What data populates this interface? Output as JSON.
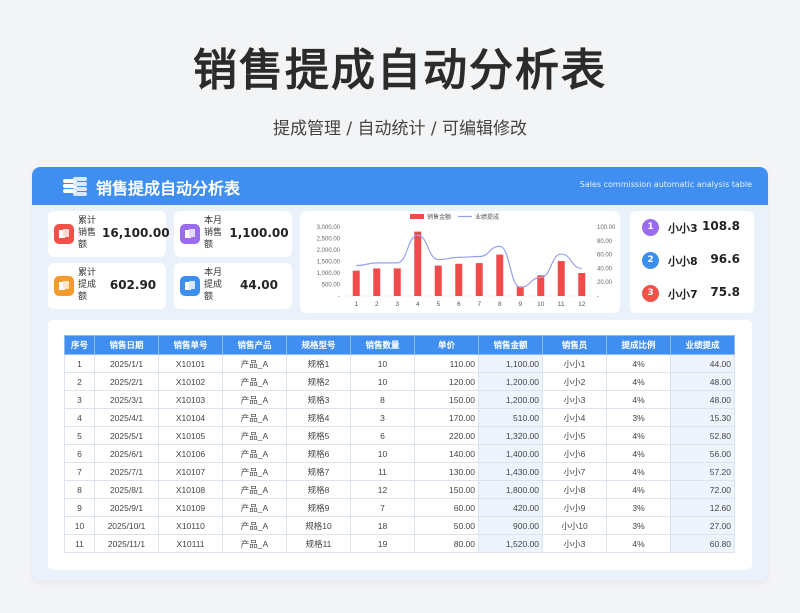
{
  "page": {
    "title": "销售提成自动分析表",
    "subtitle": "提成管理 / 自动统计 / 可编辑修改"
  },
  "header": {
    "title": "销售提成自动分析表",
    "subtitle_en": "Sales commission automatic analysis table"
  },
  "kpis": [
    {
      "label": "累计销售额",
      "value": "16,100.00",
      "color": "#f0524a",
      "icon": "stack-icon"
    },
    {
      "label": "本月销售额",
      "value": "1,100.00",
      "color": "#9b6cf0",
      "icon": "stack-icon"
    },
    {
      "label": "累计提成额",
      "value": "602.90",
      "color": "#f59a2c",
      "icon": "stack-icon"
    },
    {
      "label": "本月提成额",
      "value": "44.00",
      "color": "#3a8ff0",
      "icon": "stack-icon"
    }
  ],
  "chart_data": {
    "type": "bar",
    "legend": [
      "销售金额",
      "业绩提成"
    ],
    "categories": [
      "1",
      "2",
      "3",
      "4",
      "5",
      "6",
      "7",
      "8",
      "9",
      "10",
      "11",
      "12"
    ],
    "series": [
      {
        "name": "销售金额",
        "type": "bar",
        "axis": "left",
        "values": [
          1100,
          1200,
          1200,
          2800,
          1320,
          1400,
          1430,
          1800,
          420,
          900,
          1520,
          1000
        ]
      },
      {
        "name": "业绩提成",
        "type": "line",
        "axis": "right",
        "values": [
          44,
          48,
          48,
          88,
          52.8,
          56,
          57.2,
          72,
          12.6,
          27,
          60.8,
          40
        ]
      }
    ],
    "left_ticks": [
      "3,000.00",
      "2,500.00",
      "2,000.00",
      "1,500.00",
      "1,000.00",
      "500.00",
      "-"
    ],
    "right_ticks": [
      "100.00",
      "80.00",
      "60.00",
      "40.00",
      "20.00",
      "-"
    ],
    "ylim_left": [
      0,
      3000
    ],
    "ylim_right": [
      0,
      100
    ],
    "colors": {
      "bar": "#ef4b4b",
      "line": "#9aa0f0"
    }
  },
  "ranking": [
    {
      "rank": "1",
      "name": "小小3",
      "score": "108.8",
      "color": "#9b6cf0"
    },
    {
      "rank": "2",
      "name": "小小8",
      "score": "96.6",
      "color": "#3a8ff0"
    },
    {
      "rank": "3",
      "name": "小小7",
      "score": "75.8",
      "color": "#f0524a"
    }
  ],
  "table": {
    "headers": [
      "序号",
      "销售日期",
      "销售单号",
      "销售产品",
      "规格型号",
      "销售数量",
      "单价",
      "销售金额",
      "销售员",
      "提成比例",
      "业绩提成"
    ],
    "rows": [
      [
        "1",
        "2025/1/1",
        "X10101",
        "产品_A",
        "规格1",
        "10",
        "110.00",
        "1,100.00",
        "小小1",
        "4%",
        "44.00"
      ],
      [
        "2",
        "2025/2/1",
        "X10102",
        "产品_A",
        "规格2",
        "10",
        "120.00",
        "1,200.00",
        "小小2",
        "4%",
        "48.00"
      ],
      [
        "3",
        "2025/3/1",
        "X10103",
        "产品_A",
        "规格3",
        "8",
        "150.00",
        "1,200.00",
        "小小3",
        "4%",
        "48.00"
      ],
      [
        "4",
        "2025/4/1",
        "X10104",
        "产品_A",
        "规格4",
        "3",
        "170.00",
        "510.00",
        "小小4",
        "3%",
        "15.30"
      ],
      [
        "5",
        "2025/5/1",
        "X10105",
        "产品_A",
        "规格5",
        "6",
        "220.00",
        "1,320.00",
        "小小5",
        "4%",
        "52.80"
      ],
      [
        "6",
        "2025/6/1",
        "X10106",
        "产品_A",
        "规格6",
        "10",
        "140.00",
        "1,400.00",
        "小小6",
        "4%",
        "56.00"
      ],
      [
        "7",
        "2025/7/1",
        "X10107",
        "产品_A",
        "规格7",
        "11",
        "130.00",
        "1,430.00",
        "小小7",
        "4%",
        "57.20"
      ],
      [
        "8",
        "2025/8/1",
        "X10108",
        "产品_A",
        "规格8",
        "12",
        "150.00",
        "1,800.00",
        "小小8",
        "4%",
        "72.00"
      ],
      [
        "9",
        "2025/9/1",
        "X10109",
        "产品_A",
        "规格9",
        "7",
        "60.00",
        "420.00",
        "小小9",
        "3%",
        "12.60"
      ],
      [
        "10",
        "2025/10/1",
        "X10110",
        "产品_A",
        "规格10",
        "18",
        "50.00",
        "900.00",
        "小小10",
        "3%",
        "27.00"
      ],
      [
        "11",
        "2025/11/1",
        "X10111",
        "产品_A",
        "规格11",
        "19",
        "80.00",
        "1,520.00",
        "小小3",
        "4%",
        "60.80"
      ]
    ]
  }
}
